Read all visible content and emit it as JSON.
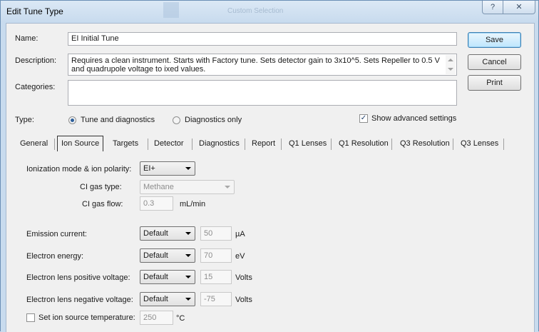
{
  "window": {
    "title": "Edit Tune Type",
    "ghost_title": "Custom Selection",
    "help_glyph": "?",
    "close_glyph": "✕"
  },
  "form": {
    "name_label": "Name:",
    "name_value": "EI Initial Tune",
    "description_label": "Description:",
    "description_value": "Requires a clean instrument. Starts with Factory tune. Sets detector gain to 3x10^5. Sets Repeller to 0.5 V and quadrupole voltage to ixed values.",
    "categories_label": "Categories:",
    "categories_value": "",
    "type_label": "Type:",
    "type_options": [
      "Tune and diagnostics",
      "Diagnostics only"
    ],
    "type_selected": "Tune and diagnostics",
    "show_advanced_label": "Show advanced settings",
    "show_advanced_checked": true
  },
  "buttons": {
    "save": "Save",
    "cancel": "Cancel",
    "print": "Print"
  },
  "tabs": [
    "General",
    "Ion Source",
    "Targets",
    "Detector",
    "Diagnostics",
    "Report",
    "Q1 Lenses",
    "Q1 Resolution",
    "Q3 Resolution",
    "Q3 Lenses"
  ],
  "active_tab": "Ion Source",
  "ion_source": {
    "ionization_label": "Ionization mode & ion polarity:",
    "ionization_value": "EI+",
    "ci_gas_type_label": "CI gas type:",
    "ci_gas_type_value": "Methane",
    "ci_gas_flow_label": "CI gas flow:",
    "ci_gas_flow_value": "0.3",
    "ci_gas_flow_unit": "mL/min",
    "emission_label": "Emission current:",
    "emission_mode": "Default",
    "emission_value": "50",
    "emission_unit": "µA",
    "energy_label": "Electron energy:",
    "energy_mode": "Default",
    "energy_value": "70",
    "energy_unit": "eV",
    "lens_pos_label": "Electron lens positive voltage:",
    "lens_pos_mode": "Default",
    "lens_pos_value": "15",
    "lens_pos_unit": "Volts",
    "lens_neg_label": "Electron lens negative voltage:",
    "lens_neg_mode": "Default",
    "lens_neg_value": "-75",
    "lens_neg_unit": "Volts",
    "temp_label": "Set ion source temperature:",
    "temp_checked": false,
    "temp_value": "250",
    "temp_unit": "°C"
  }
}
